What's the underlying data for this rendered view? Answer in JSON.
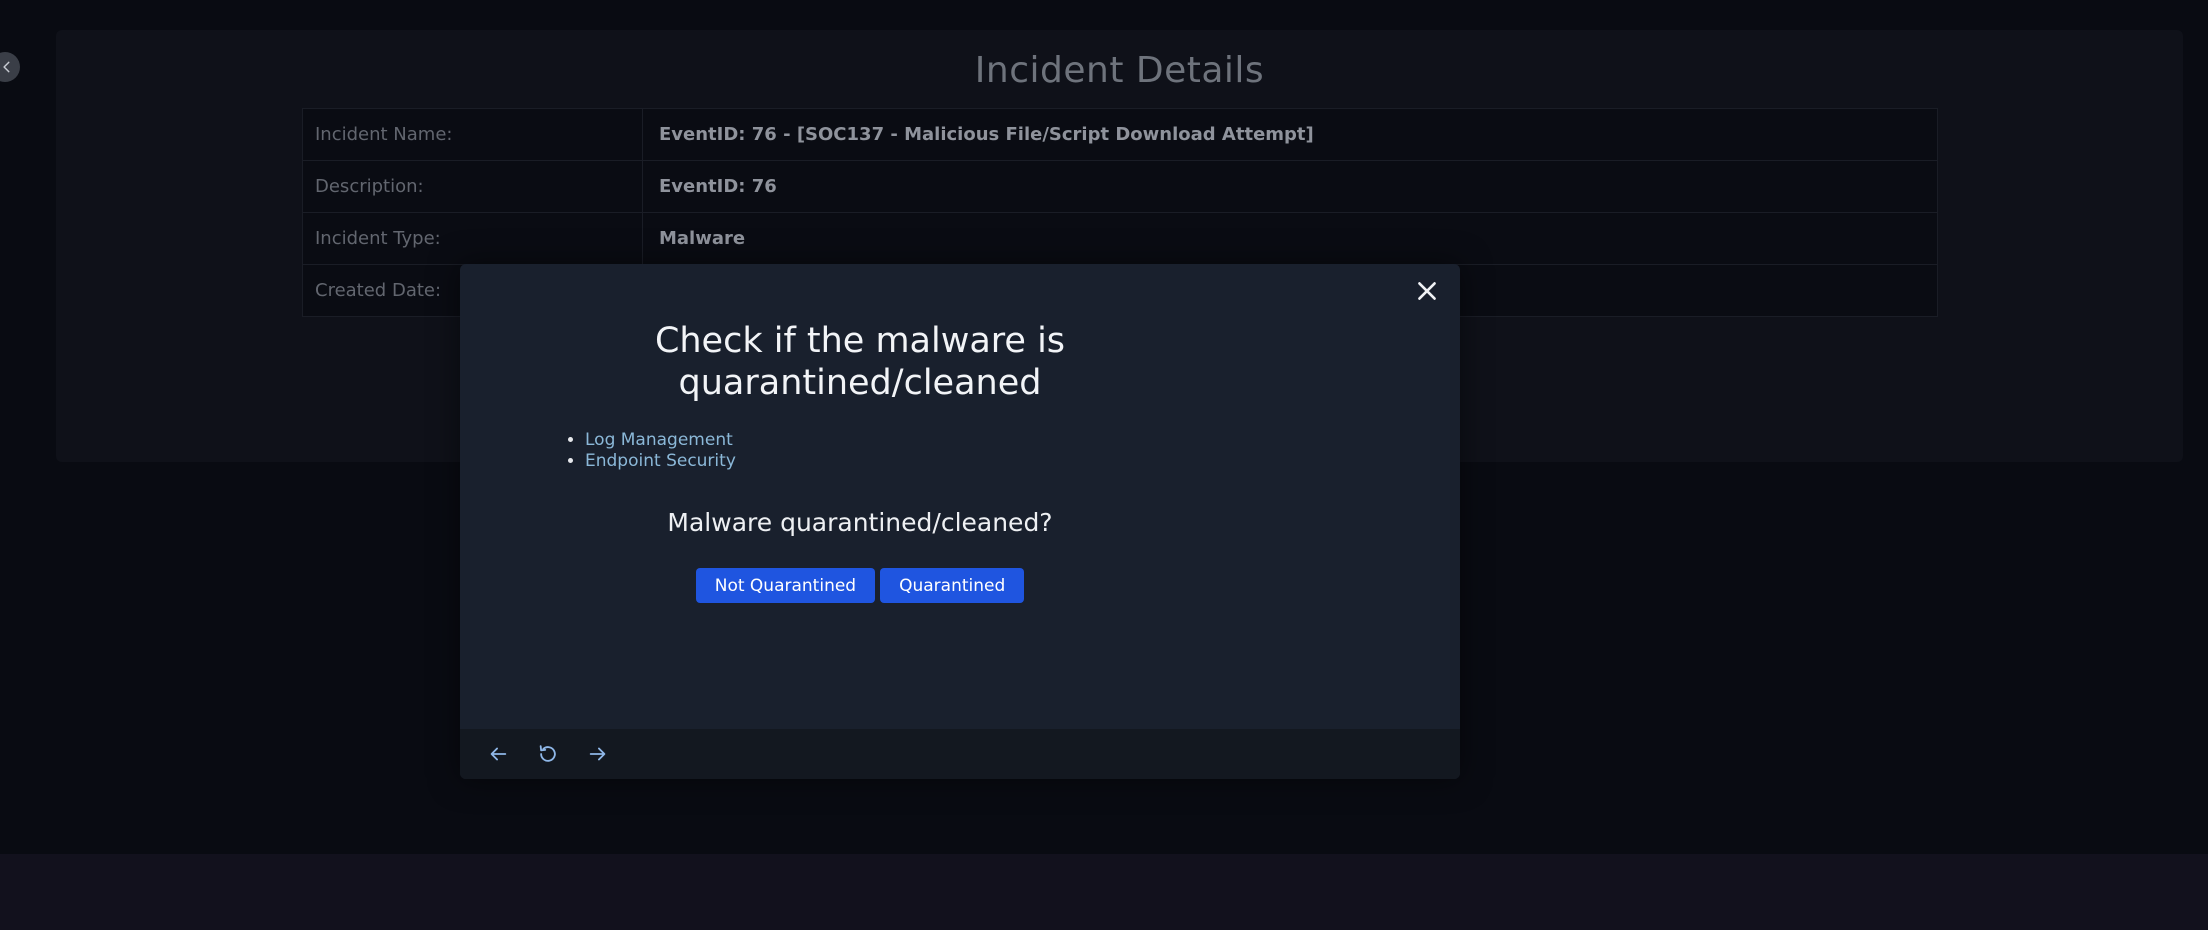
{
  "details": {
    "title": "Incident Details",
    "rows": [
      {
        "label": "Incident Name:",
        "value": "EventID: 76 - [SOC137 - Malicious File/Script Download Attempt]"
      },
      {
        "label": "Description:",
        "value": "EventID: 76"
      },
      {
        "label": "Incident Type:",
        "value": "Malware"
      },
      {
        "label": "Created Date:",
        "value": ""
      }
    ]
  },
  "modal": {
    "title": "Check if the malware is quarantined/cleaned",
    "links": [
      "Log Management",
      "Endpoint Security"
    ],
    "question": "Malware quarantined/cleaned?",
    "buttons": {
      "not_quarantined": "Not Quarantined",
      "quarantined": "Quarantined"
    }
  },
  "colors": {
    "accent_button": "#1f55e0",
    "link": "#8bb8d8",
    "modal_bg": "#19202d",
    "page_bg": "#090b12"
  },
  "icons": {
    "close": "close-icon",
    "back": "arrow-left-icon",
    "reset": "rotate-ccw-icon",
    "forward": "arrow-right-icon",
    "collapse": "chevron-left-icon"
  }
}
